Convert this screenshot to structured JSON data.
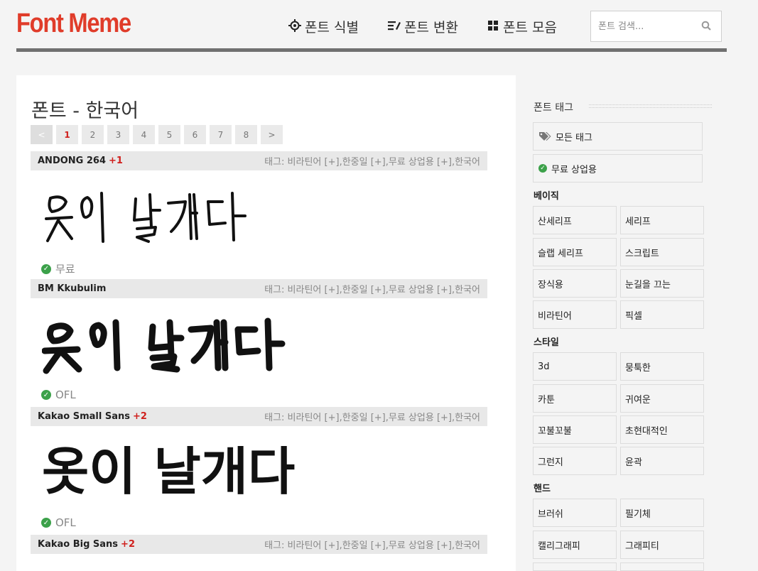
{
  "header": {
    "logo": "Font Meme",
    "nav": [
      {
        "label": "폰트 식별",
        "icon": "crosshair-icon"
      },
      {
        "label": "폰트 변환",
        "icon": "edit-list-icon"
      },
      {
        "label": "폰트 모음",
        "icon": "grid-icon"
      }
    ],
    "search_placeholder": "폰트 검색..."
  },
  "main": {
    "title": "폰트 - 한국어",
    "pagination": [
      "<",
      "1",
      "2",
      "3",
      "4",
      "5",
      "6",
      "7",
      "8",
      ">"
    ],
    "active_page": "1",
    "fonts": [
      {
        "name": "ANDONG 264",
        "count": "+1",
        "tags": "태그: 비라틴어 [+],한중일 [+],무료 상업용 [+],한국어",
        "preview": "옷이 날개다",
        "license": "무료"
      },
      {
        "name": "BM Kkubulim",
        "count": "",
        "tags": "태그: 비라틴어 [+],한중일 [+],무료 상업용 [+],한국어",
        "preview": "옷이 날개다",
        "license": "OFL"
      },
      {
        "name": "Kakao Small Sans",
        "count": "+2",
        "tags": "태그: 비라틴어 [+],한중일 [+],무료 상업용 [+],한국어",
        "preview": "옷이 날개다",
        "license": "OFL"
      },
      {
        "name": "Kakao Big Sans",
        "count": "+2",
        "tags": "태그: 비라틴어 [+],한중일 [+],무료 상업용 [+],한국어"
      }
    ]
  },
  "sidebar": {
    "title": "폰트 태그",
    "all_tags": "모든 태그",
    "free_commercial": "무료 상업용",
    "sections": [
      {
        "heading": "베이직",
        "tags": [
          "산세리프",
          "세리프",
          "슬랩 세리프",
          "스크립트",
          "장식용",
          "눈길을 끄는",
          "비라틴어",
          "픽셀"
        ]
      },
      {
        "heading": "스타일",
        "tags": [
          "3d",
          "뭉툭한",
          "카툰",
          "귀여운",
          "꼬불꼬불",
          "초현대적인",
          "그런지",
          "윤곽"
        ]
      },
      {
        "heading": "핸드",
        "tags": [
          "브러쉬",
          "필기체",
          "캘리그래피",
          "그래피티"
        ]
      }
    ]
  }
}
